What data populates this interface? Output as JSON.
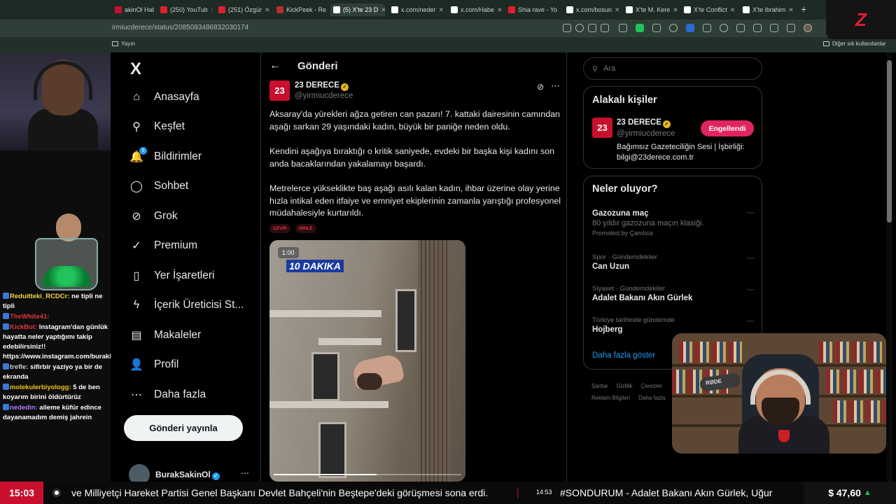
{
  "browser": {
    "tabs": [
      {
        "label": "akinOl Habe",
        "color": "#c8102e"
      },
      {
        "label": "(250) YouTub",
        "color": "#e01e2e"
      },
      {
        "label": "(251) Özgür",
        "color": "#e01e2e"
      },
      {
        "label": "KickPeek - Re",
        "color": "#b03030"
      },
      {
        "label": "(5) X'te 23 D",
        "color": "#ffffff",
        "active": true
      },
      {
        "label": "x.com/neder",
        "color": "#ffffff"
      },
      {
        "label": "x.com/Habe",
        "color": "#ffffff"
      },
      {
        "label": "Shia rave - Yo",
        "color": "#e01e2e"
      },
      {
        "label": "x.com/bosun",
        "color": "#ffffff"
      },
      {
        "label": "X'te M. Kere",
        "color": "#ffffff"
      },
      {
        "label": "X'te Conflict",
        "color": "#ffffff"
      },
      {
        "label": "X'te ibrahim",
        "color": "#ffffff"
      }
    ],
    "new_tab": "+",
    "url": "irmiucderece/status/2085093486832030174",
    "bookmark_left": "Yayın",
    "bookmark_right": "Diğer sık kullanılanlar"
  },
  "stream_chat": [
    {
      "user": "Reduitteki_RCDCr:",
      "text": "ne tipli ne tipli",
      "color": "#f5d742"
    },
    {
      "user": "TheWhite41:",
      "text": "",
      "color": "#e0353d"
    },
    {
      "user": "KickBot:",
      "text": "Instagram'dan günlük hayatta neler yaptığımı takip edebilirsiniz!! https://www.instagram.com/burakkut/",
      "color": "#e0353d"
    },
    {
      "user": "trefle:",
      "text": "sifirbir yaziyo ya bir de ekranda",
      "color": "#c8d0cc"
    },
    {
      "user": "molekulerbiyologg:",
      "text": "5 de ben koyarım birini öldürtürüz",
      "color": "#f0c419"
    },
    {
      "user": "nededin:",
      "text": "ailemе küfür edince dayanamadım demiş jahrein",
      "color": "#b07bff"
    }
  ],
  "nav": {
    "logo": "X",
    "items": [
      {
        "label": "Anasayfa",
        "icon": "home-icon",
        "glyph": "⌂"
      },
      {
        "label": "Keşfet",
        "icon": "search-icon",
        "glyph": "⚲"
      },
      {
        "label": "Bildirimler",
        "icon": "bell-icon",
        "glyph": "🔔",
        "badge": "5"
      },
      {
        "label": "Sohbet",
        "icon": "chat-icon",
        "glyph": "◯"
      },
      {
        "label": "Grok",
        "icon": "grok-icon",
        "glyph": "⊘"
      },
      {
        "label": "Premium",
        "icon": "premium-icon",
        "glyph": "✓"
      },
      {
        "label": "Yer İşaretleri",
        "icon": "bookmark-icon",
        "glyph": "▯"
      },
      {
        "label": "İçerik Üreticisi St...",
        "icon": "lightning-icon",
        "glyph": "ϟ"
      },
      {
        "label": "Makaleler",
        "icon": "article-icon",
        "glyph": "▤"
      },
      {
        "label": "Profil",
        "icon": "profile-icon",
        "glyph": "👤"
      },
      {
        "label": "Daha fazla",
        "icon": "more-icon",
        "glyph": "⋯"
      }
    ],
    "post_button": "Gönderi yayınla",
    "account_name": "BurakSakinOl"
  },
  "main": {
    "header_title": "Gönderi",
    "tweet": {
      "avatar_text": "23",
      "name": "23 DERECE",
      "handle": "@yirmiucderece",
      "paragraphs": [
        "Aksaray'da yürekleri ağza getiren can pazarı!  7. kattaki dairesinin camından aşağı sarkan 29 yaşındaki kadın, büyük bir paniğe neden oldu.",
        "Kendini aşağıya bıraktığı o kritik saniyede, evdeki bir başka kişi kadını son anda bacaklarından yakalamayı başardı.",
        "Metrelerce yükseklikte baş aşağı asılı kalan kadın, ihbar üzerine olay yerine hızla intikal eden itfaiye ve emniyet ekiplerinin zamanla yarıştığı profesyonel müdahalesiyle kurtarıldı."
      ],
      "tags": [
        "ÇEVİR",
        "DİNLE"
      ],
      "video": {
        "duration": "1:00",
        "overlay_label": "10 DAKIKA",
        "progress_fraction": 0.55
      }
    }
  },
  "right": {
    "search_placeholder": "Ara",
    "related_title": "Alakalı kişiler",
    "related": {
      "avatar_text": "23",
      "name": "23 DERECE",
      "handle": "@yirmiucderece",
      "bio": "Bağımsız Gazeteciliğin Sesi | İşbirliği: bilgi@23derece.com.tr",
      "button": "Engellendi"
    },
    "trends_title": "Neler oluyor?",
    "trends": [
      {
        "meta": "",
        "title": "Gazozuna maç",
        "sub": "80 yıldır gazozuna maçın klasiği.",
        "promo": "Promoted by Çamlıca"
      },
      {
        "meta": "Spor · Gündemdekiler",
        "title": "Can Uzun",
        "sub": "",
        "promo": ""
      },
      {
        "meta": "Siyaset · Gündemdekiler",
        "title": "Adalet Bakanı Akın Gürlek",
        "sub": "",
        "promo": ""
      },
      {
        "meta": "Türkiye tarihinde gündemde",
        "title": "Hojberg",
        "sub": "",
        "promo": ""
      }
    ],
    "show_more": "Daha fazla göster",
    "footer": [
      "Şartlar",
      "Gizlilik",
      "Çerezler",
      "Reklam Bilgileri",
      "Daha fazla"
    ]
  },
  "overlay": {
    "stream_logo": "Z",
    "mic_brand": "RØDE"
  },
  "ticker": {
    "clock": "15:03",
    "headline": "ve Milliyetçi Hareket Partisi Genel Başkanı Devlet Bahçeli'nin Beştepe'deki görüşmesi sona erdi.",
    "separator": "|",
    "time2": "14:53",
    "headline2": "#SONDURUM - Adalet Bakanı Akın Gürlek, Uğur",
    "price": "$ 47,60",
    "price_trend": "▲"
  }
}
